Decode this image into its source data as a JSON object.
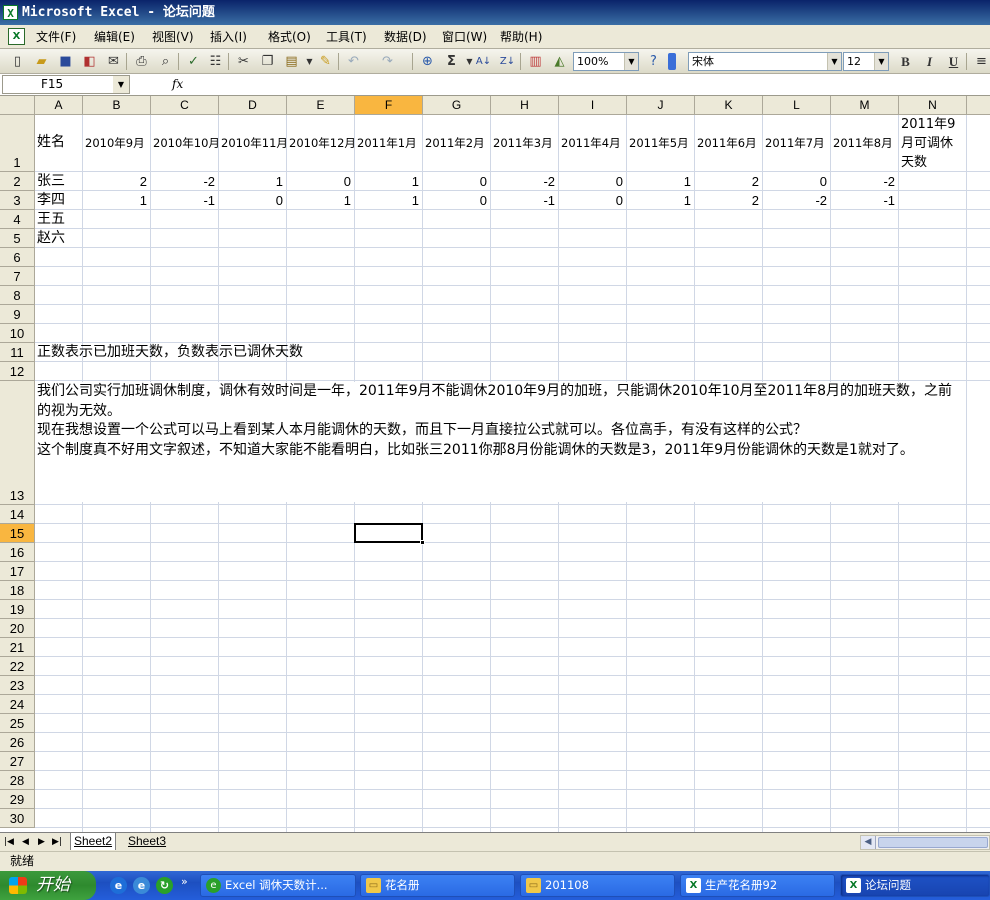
{
  "window": {
    "title": "Microsoft Excel - 论坛问题"
  },
  "menu": {
    "items": [
      "文件(F)",
      "编辑(E)",
      "视图(V)",
      "插入(I)",
      "格式(O)",
      "工具(T)",
      "数据(D)",
      "窗口(W)",
      "帮助(H)"
    ]
  },
  "toolbar": {
    "zoom": "100%",
    "font_name": "宋体",
    "font_size": "12",
    "bold": "B",
    "italic": "I",
    "underline": "U"
  },
  "formula_bar": {
    "name_box": "F15",
    "fx": "fx",
    "formula": ""
  },
  "sheet": {
    "columns": [
      "A",
      "B",
      "C",
      "D",
      "E",
      "F",
      "G",
      "H",
      "I",
      "J",
      "K",
      "L",
      "M",
      "N"
    ],
    "active_column": "F",
    "active_row": "15",
    "rows": [
      "1",
      "2",
      "3",
      "4",
      "5",
      "6",
      "7",
      "8",
      "9",
      "10",
      "11",
      "12",
      "13",
      "14",
      "15",
      "16",
      "17",
      "18",
      "19",
      "20",
      "21",
      "22",
      "23",
      "24",
      "25",
      "26",
      "27",
      "28",
      "29",
      "30"
    ],
    "header_row": [
      "姓名",
      "2010年9月",
      "2010年10月",
      "2010年11月",
      "2010年12月",
      "2011年1月",
      "2011年2月",
      "2011年3月",
      "2011年4月",
      "2011年5月",
      "2011年6月",
      "2011年7月",
      "2011年8月",
      "2011年9月可调休天数"
    ],
    "data": [
      {
        "name": "张三",
        "values": [
          "2",
          "-2",
          "1",
          "0",
          "1",
          "0",
          "-2",
          "0",
          "1",
          "2",
          "0",
          "-2"
        ]
      },
      {
        "name": "李四",
        "values": [
          "1",
          "-1",
          "0",
          "1",
          "1",
          "0",
          "-1",
          "0",
          "1",
          "2",
          "-2",
          "-1"
        ]
      },
      {
        "name": "王五",
        "values": []
      },
      {
        "name": "赵六",
        "values": []
      }
    ],
    "note_row11": "正数表示已加班天数，负数表示已调休天数",
    "note_row13": "我们公司实行加班调休制度，调休有效时间是一年，2011年9月不能调休2010年9月的加班，只能调休2010年10月至2011年8月的加班天数，之前的视为无效。\n现在我想设置一个公式可以马上看到某人本月能调休的天数，而且下一月直接拉公式就可以。各位高手，有没有这样的公式？\n这个制度真不好用文字叙述，不知道大家能不能看明白，比如张三2011你那8月份能调休的天数是3，2011年9月份能调休的天数是1就对了。"
  },
  "tabs": {
    "nav": [
      "|◀",
      "◀",
      "▶",
      "▶|"
    ],
    "sheets": [
      "Sheet2",
      "Sheet3"
    ]
  },
  "status": {
    "text": "就绪"
  },
  "taskbar": {
    "start": "开始",
    "buttons": [
      {
        "label": "Excel 调休天数计...",
        "active": false
      },
      {
        "label": "花名册",
        "active": false
      },
      {
        "label": "201108",
        "active": false
      },
      {
        "label": "生产花名册92",
        "active": false
      },
      {
        "label": "论坛问题",
        "active": true
      }
    ]
  }
}
